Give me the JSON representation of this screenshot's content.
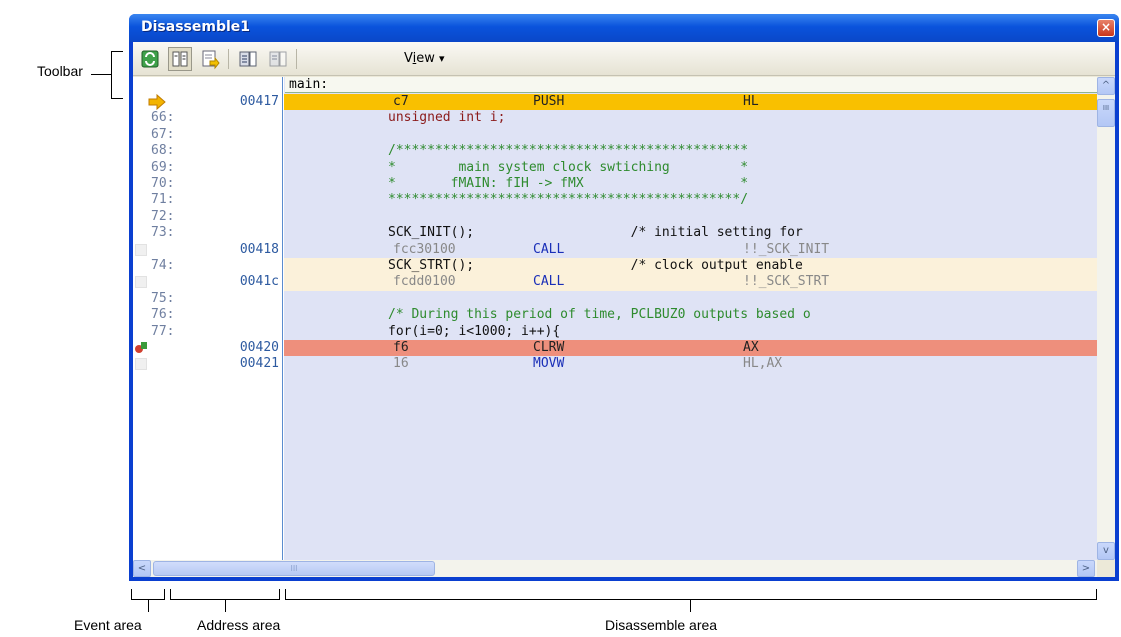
{
  "annotations": {
    "toolbar": "Toolbar",
    "event_area": "Event area",
    "address_area": "Address area",
    "disassemble_area": "Disassemble area"
  },
  "window": {
    "title": "Disassemble1",
    "close_glyph": "×",
    "menu_view_prefix": "V",
    "menu_view_u": "i",
    "menu_view_suffix": "ew",
    "menu_arrow": "▾"
  },
  "toolbar_icons": [
    "refresh-icon",
    "mixed-display-icon",
    "jump-to-source-icon",
    "step-in-icon",
    "step-over-icon"
  ],
  "header_line": "main:",
  "rows": [
    {
      "kind": "asm",
      "addr": "00417",
      "code": "c7",
      "mn": "PUSH",
      "op": "HL",
      "hl": "pc"
    },
    {
      "kind": "src",
      "ln": "66:",
      "text": "unsigned int i;"
    },
    {
      "kind": "src",
      "ln": "67:",
      "text": ""
    },
    {
      "kind": "src",
      "ln": "68:",
      "text": "/*********************************************"
    },
    {
      "kind": "src",
      "ln": "69:",
      "text": "*        main system clock swtiching         *"
    },
    {
      "kind": "src",
      "ln": "70:",
      "text": "*       fMAIN: fIH -> fMX                    *"
    },
    {
      "kind": "src",
      "ln": "71:",
      "text": "*********************************************/"
    },
    {
      "kind": "src",
      "ln": "72:",
      "text": ""
    },
    {
      "kind": "src",
      "ln": "73:",
      "text": "SCK_INIT();                    /* initial setting for"
    },
    {
      "kind": "asm",
      "addr": "00418",
      "code": "fcc30100",
      "mn": "CALL",
      "op": "!!_SCK_INIT",
      "hl": "none"
    },
    {
      "kind": "src",
      "ln": "74:",
      "text": "SCK_STRT();                    /* clock output enable",
      "hl": "cur"
    },
    {
      "kind": "asm",
      "addr": "0041c",
      "code": "fcdd0100",
      "mn": "CALL",
      "op": "!!_SCK_STRT",
      "hl": "cur"
    },
    {
      "kind": "src",
      "ln": "75:",
      "text": ""
    },
    {
      "kind": "src",
      "ln": "76:",
      "text": "/* During this period of time, PCLBUZ0 outputs based o"
    },
    {
      "kind": "src",
      "ln": "77:",
      "text": "for(i=0; i<1000; i++){"
    },
    {
      "kind": "asm",
      "addr": "00420",
      "code": "f6",
      "mn": "CLRW",
      "op": "AX",
      "hl": "bp"
    },
    {
      "kind": "asm",
      "addr": "00421",
      "code": "16",
      "mn": "MOVW",
      "op": "HL,AX",
      "hl": "none"
    }
  ],
  "colors": {
    "pc_highlight": "#f9c000",
    "breakpoint": "#ee8f7c",
    "cursor_line": "#fbf1da",
    "source_text": "#8b1a1a",
    "comment_text": "#2e8b2e"
  },
  "scroll": {
    "left_arrow": "<",
    "right_arrow": ">",
    "up_arrow": "^",
    "down_arrow": "v",
    "grip": "III"
  }
}
